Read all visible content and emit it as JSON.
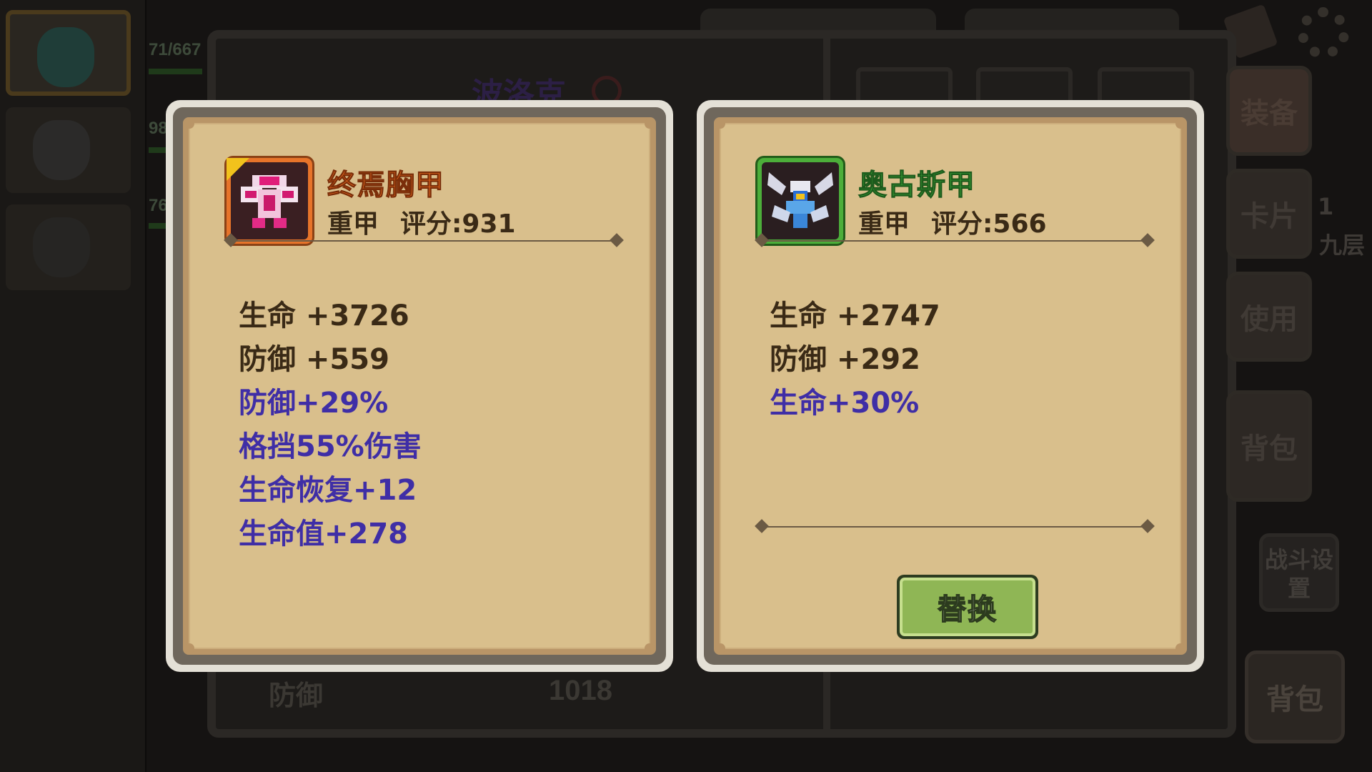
{
  "background": {
    "hero_hp_values": [
      "71/667",
      "98",
      "76"
    ],
    "hero_name": "波洛克",
    "stat_label": "防御",
    "stat_value": "1018",
    "tabs": [
      "装备",
      "卡片",
      "使用",
      "背包"
    ],
    "side_number": "1",
    "side_floor": "九层",
    "battle_settings": "战斗设置",
    "bag_label": "背包"
  },
  "equipped_item": {
    "name": "终焉胸甲",
    "type": "重甲",
    "score": "评分:931",
    "rarity_color": "#e7742a",
    "icon": "armor-pink-chestplate-icon",
    "base_stats": [
      "生命 +3726",
      "防御 +559"
    ],
    "extra_stats": [
      "防御+29%",
      "格挡55%伤害",
      "生命恢复+12",
      "生命值+278"
    ]
  },
  "compare_item": {
    "name": "奥古斯甲",
    "type": "重甲",
    "score": "评分:566",
    "rarity_color": "#4cae3a",
    "icon": "armor-winged-blue-icon",
    "base_stats": [
      "生命 +2747",
      "防御 +292"
    ],
    "extra_stats": [
      "生命+30%"
    ],
    "replace_label": "替换"
  },
  "colors": {
    "parchment": "#d9bf8c",
    "base_stat_text": "#3a2a16",
    "extra_stat_text": "#3f2ea6"
  }
}
